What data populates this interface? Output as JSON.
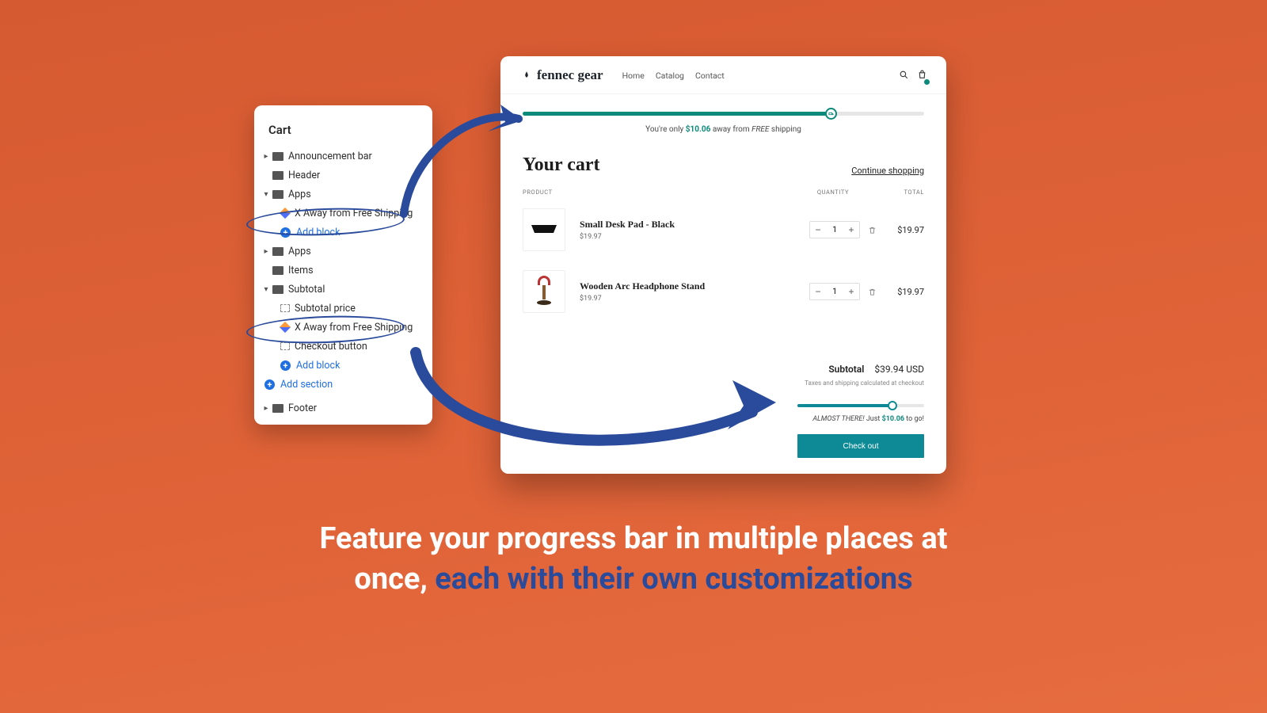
{
  "sidebar": {
    "title": "Cart",
    "rows": {
      "announcement": "Announcement bar",
      "header": "Header",
      "apps1_group": "Apps",
      "free_ship_block": "X Away from Free Shipping",
      "add_block1": "Add block",
      "apps2_group": "Apps",
      "items": "Items",
      "subtotal_group": "Subtotal",
      "subtotal_price": "Subtotal price",
      "free_ship_block2": "X Away from Free Shipping",
      "checkout_button": "Checkout button",
      "add_block2": "Add block",
      "add_section": "Add section",
      "footer": "Footer"
    }
  },
  "store": {
    "brand": "fennec gear",
    "nav": {
      "home": "Home",
      "catalog": "Catalog",
      "contact": "Contact"
    },
    "top_progress_pct": 77,
    "ship_prefix": "You're only ",
    "ship_amount": "$10.06",
    "ship_mid": " away from ",
    "ship_free": "FREE",
    "ship_suffix": " shipping",
    "cart_title": "Your cart",
    "continue_shopping": "Continue shopping",
    "cols": {
      "product": "PRODUCT",
      "quantity": "QUANTITY",
      "total": "TOTAL"
    },
    "lines": [
      {
        "title": "Small Desk Pad - Black",
        "price": "$19.97",
        "qty": "1",
        "total": "$19.97"
      },
      {
        "title": "Wooden Arc Headphone Stand",
        "price": "$19.97",
        "qty": "1",
        "total": "$19.97"
      }
    ],
    "subtotal_label": "Subtotal",
    "subtotal_value": "$39.94 USD",
    "tax_note": "Taxes and shipping calculated at checkout",
    "progress2_pct": 75,
    "almost_prefix": "ALMOST THERE!",
    "almost_mid": " Just ",
    "almost_amount": "$10.06",
    "almost_suffix": " to go!",
    "checkout": "Check out"
  },
  "marketing": {
    "line1": "Feature your progress bar in multiple places at",
    "line2a": "once",
    "line2b": ", ",
    "line2c": "each with their own customizations"
  }
}
